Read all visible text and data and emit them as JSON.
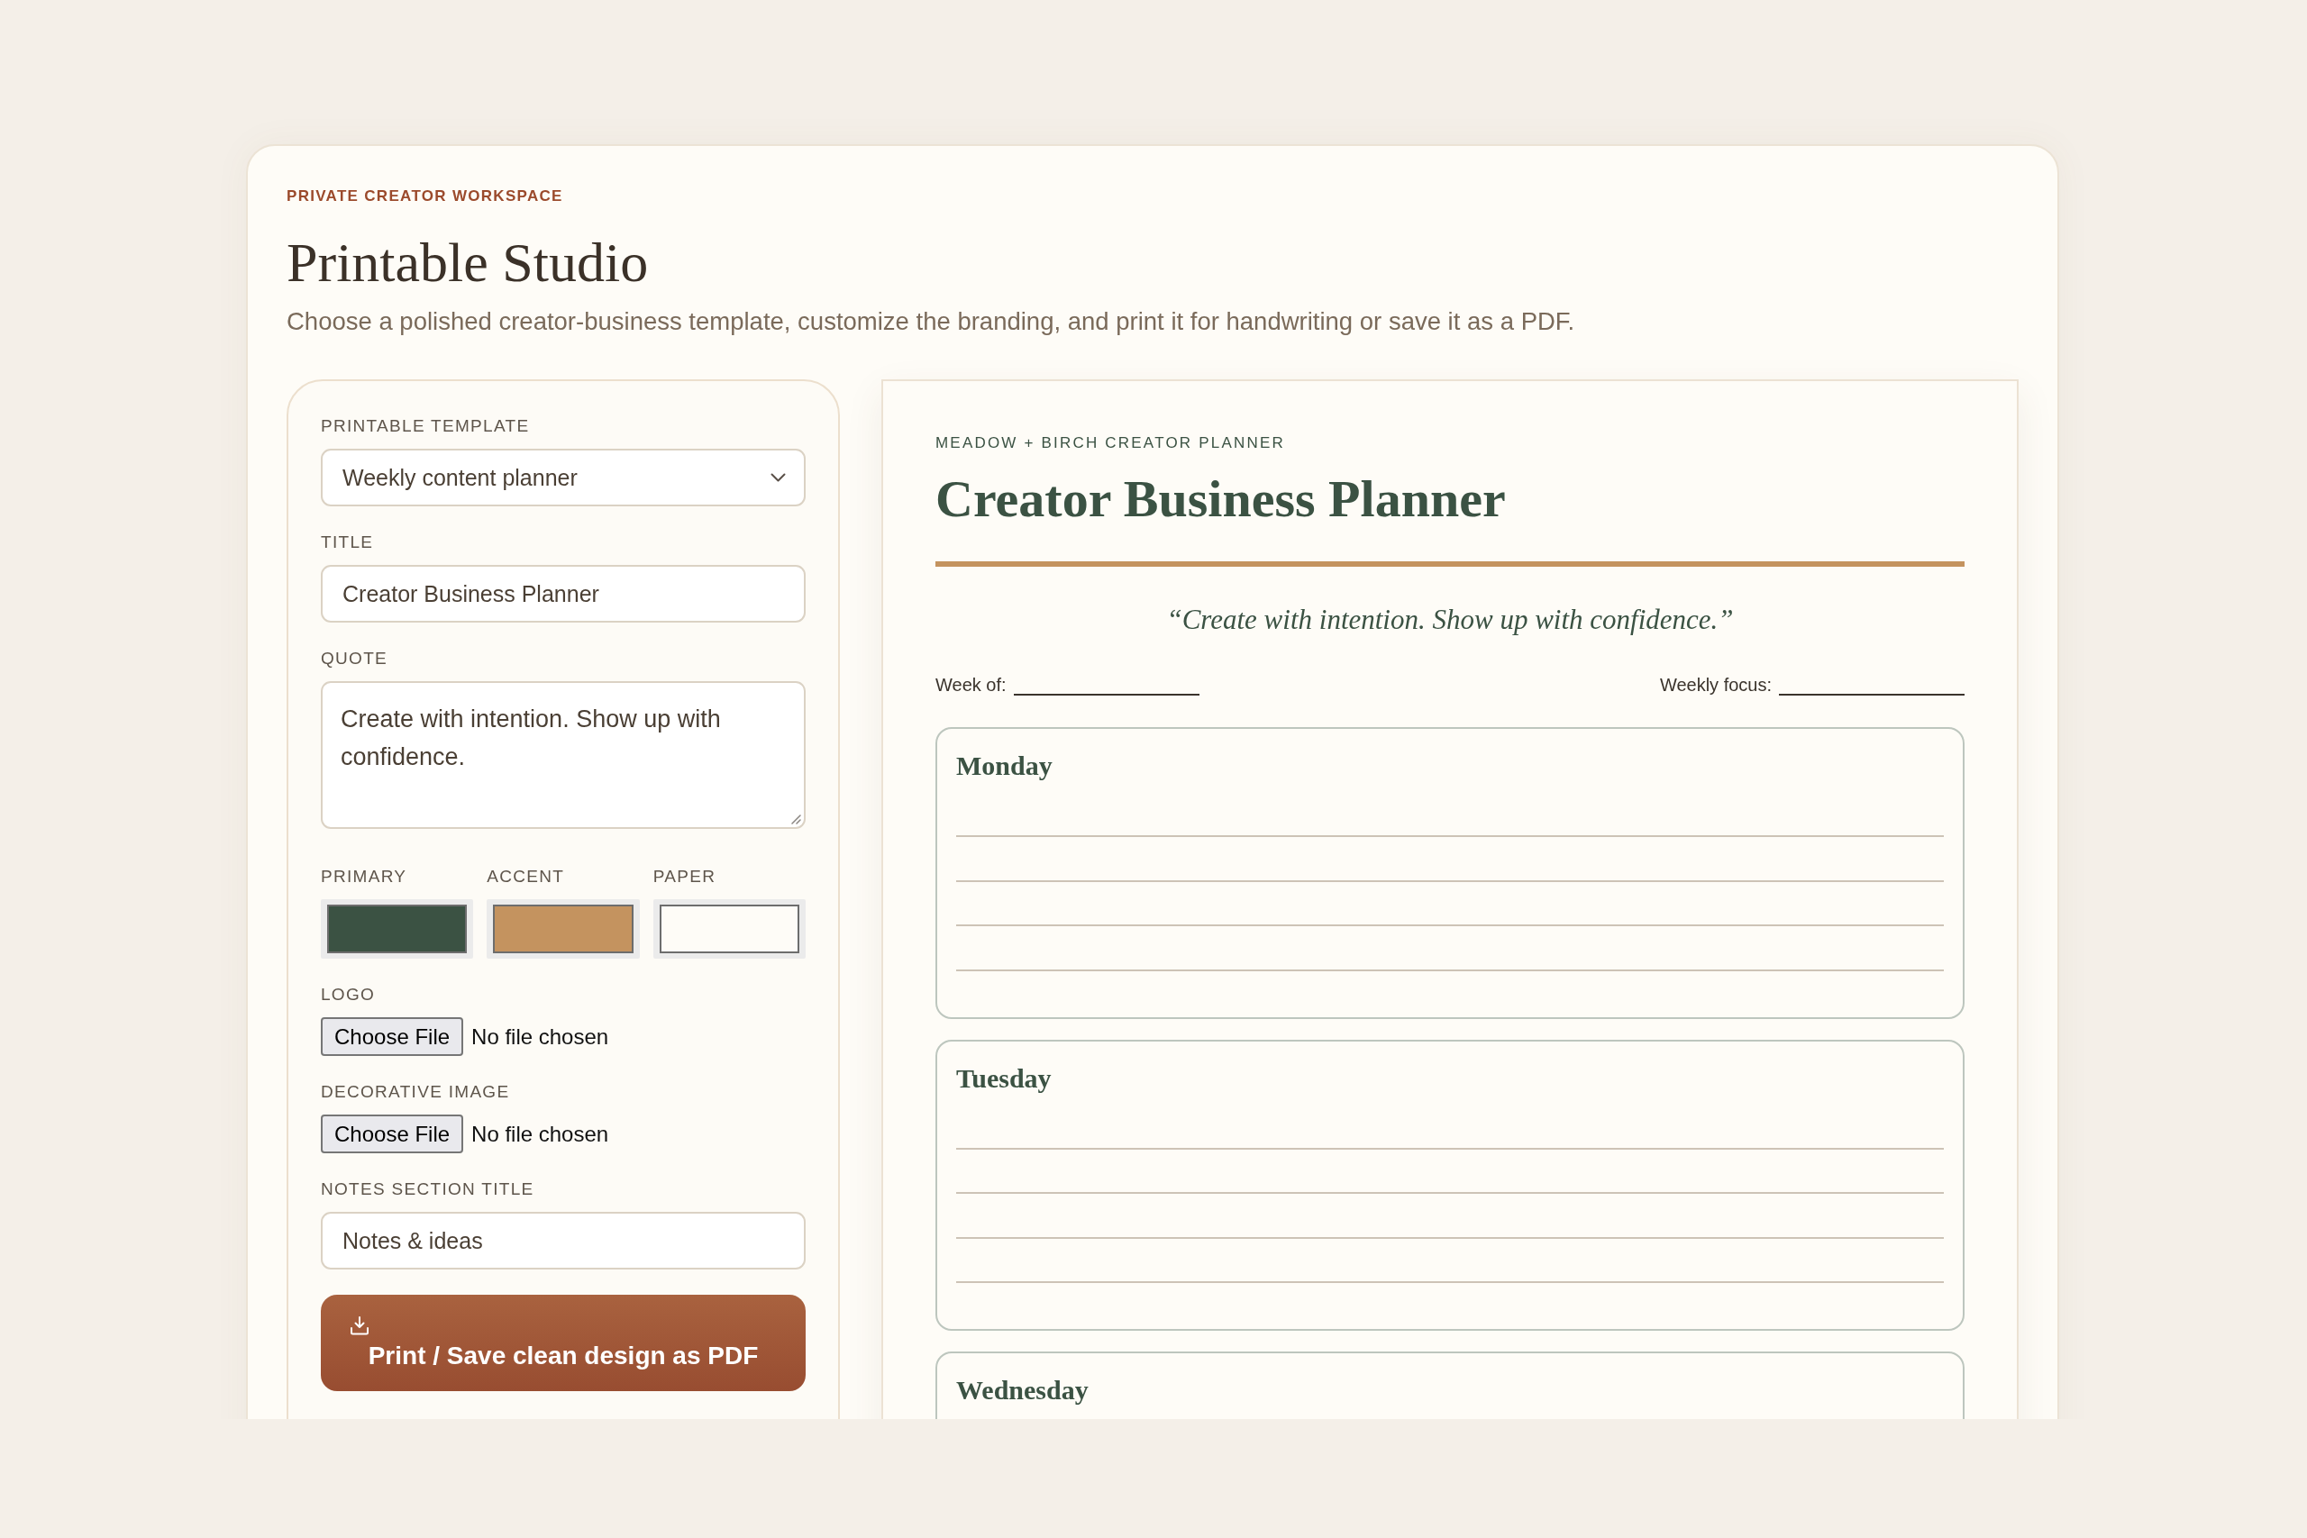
{
  "header": {
    "eyebrow": "PRIVATE CREATOR WORKSPACE",
    "title": "Printable Studio",
    "subtitle": "Choose a polished creator-business template, customize the branding, and print it for handwriting or save it as a PDF."
  },
  "controls": {
    "template": {
      "label": "PRINTABLE TEMPLATE",
      "value": "Weekly content planner"
    },
    "title": {
      "label": "TITLE",
      "value": "Creator Business Planner"
    },
    "quote": {
      "label": "QUOTE",
      "value": "Create with intention. Show up with confidence."
    },
    "colors": [
      {
        "label": "PRIMARY",
        "color": "#3b5243"
      },
      {
        "label": "ACCENT",
        "color": "#c4935f"
      },
      {
        "label": "PAPER",
        "color": "#fefcf7"
      }
    ],
    "uploads": [
      {
        "label": "LOGO",
        "button": "Choose File",
        "status": "No file chosen"
      },
      {
        "label": "DECORATIVE IMAGE",
        "button": "Choose File",
        "status": "No file chosen"
      }
    ],
    "notes_title": {
      "label": "NOTES SECTION TITLE",
      "value": "Notes & ideas"
    },
    "print_button": "Print / Save clean design as PDF"
  },
  "preview": {
    "brand": "MEADOW + BIRCH CREATOR PLANNER",
    "title": "Creator Business Planner",
    "quote": "“Create with intention. Show up with confidence.”",
    "fields": [
      {
        "label": "Week of:"
      },
      {
        "label": "Weekly focus:"
      }
    ],
    "days": [
      {
        "name": "Monday"
      },
      {
        "name": "Tuesday"
      },
      {
        "name": "Wednesday"
      }
    ]
  }
}
